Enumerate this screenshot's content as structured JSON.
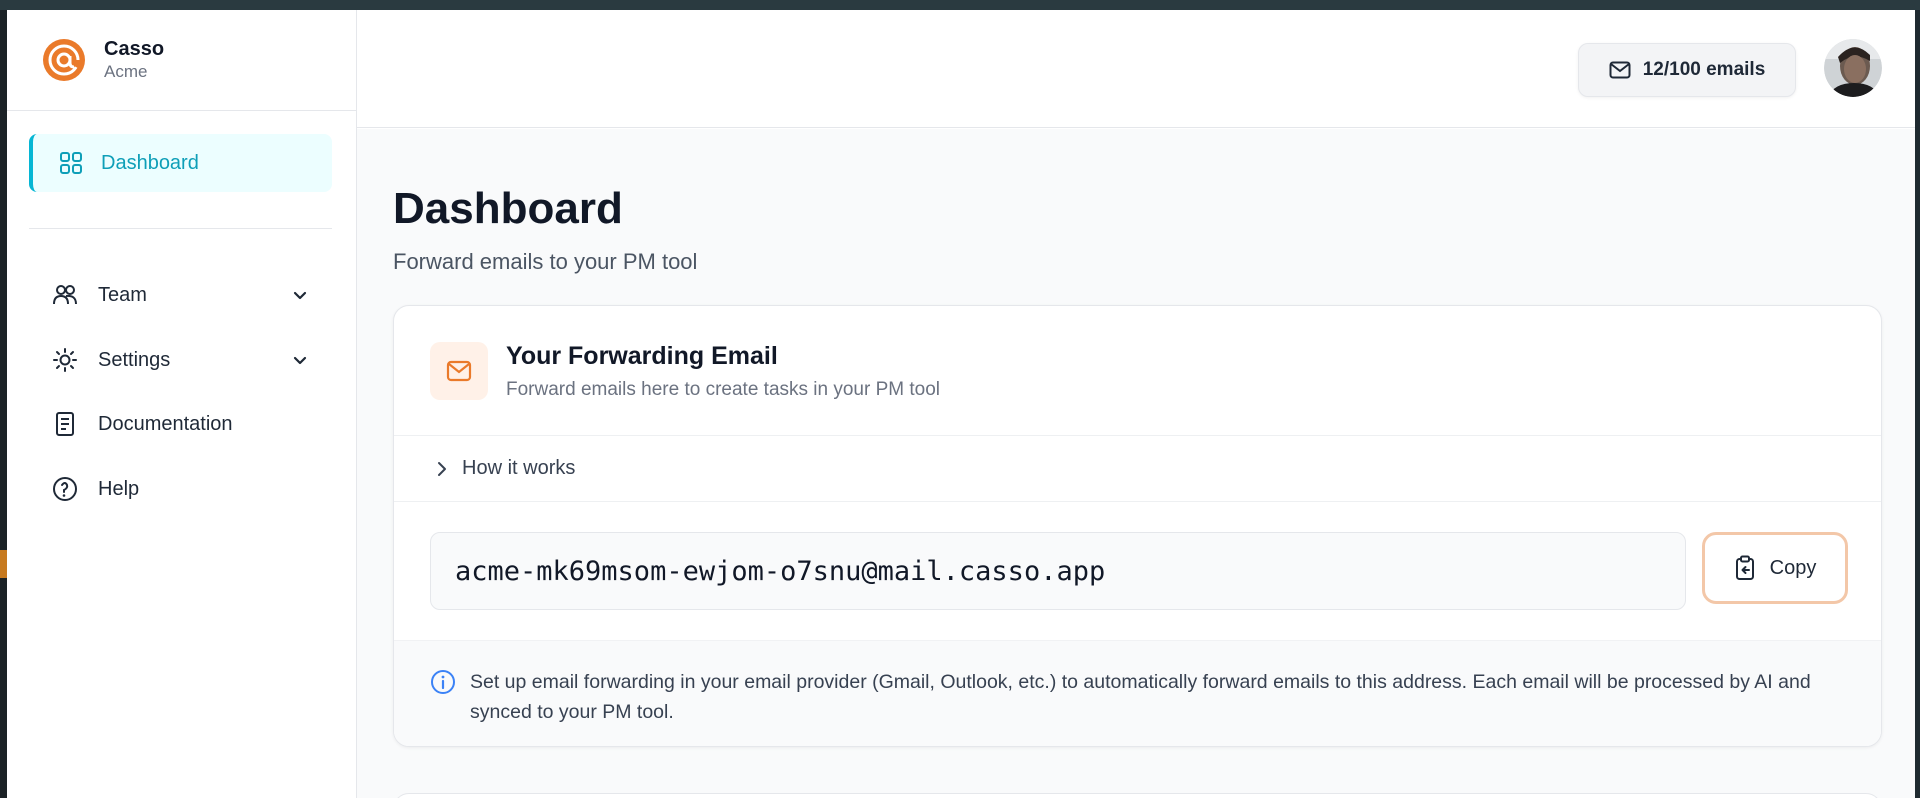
{
  "brand": {
    "name": "Casso",
    "org": "Acme",
    "logo_icon": "at-sign-logo",
    "logo_color": "#ea7a2a"
  },
  "sidebar": {
    "active": {
      "label": "Dashboard",
      "icon": "grid-icon"
    },
    "items": [
      {
        "label": "Team",
        "icon": "users-icon",
        "expandable": true
      },
      {
        "label": "Settings",
        "icon": "sun-gear-icon",
        "expandable": true
      },
      {
        "label": "Documentation",
        "icon": "document-icon",
        "expandable": false
      },
      {
        "label": "Help",
        "icon": "help-circle-icon",
        "expandable": false
      }
    ]
  },
  "header": {
    "email_quota": "12/100 emails",
    "quota_icon": "mail-icon"
  },
  "page": {
    "title": "Dashboard",
    "subtitle": "Forward emails to your PM tool"
  },
  "forwarding_card": {
    "title": "Your Forwarding Email",
    "subtitle": "Forward emails here to create tasks in your PM tool",
    "how_it_works": "How it works",
    "address": "acme-mk69msom-ewjom-o7snu@mail.casso.app",
    "copy_label": "Copy",
    "info": "Set up email forwarding in your email provider (Gmail, Outlook, etc.) to automatically forward emails to this address. Each email will be processed by AI and synced to your PM tool."
  },
  "colors": {
    "accent": "#06b6d4",
    "brand_orange": "#ea7a2a",
    "info_blue": "#3b82f6"
  }
}
